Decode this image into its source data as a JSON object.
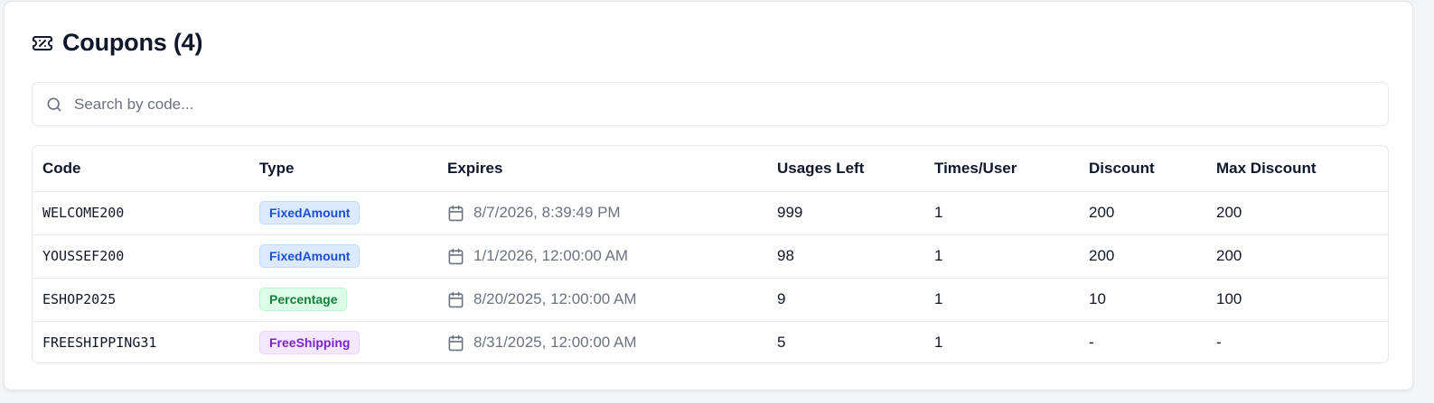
{
  "header": {
    "title": "Coupons (4)",
    "icon": "ticket-icon"
  },
  "search": {
    "placeholder": "Search by code...",
    "value": "",
    "icon": "search-icon"
  },
  "table": {
    "columns": [
      "Code",
      "Type",
      "Expires",
      "Usages Left",
      "Times/User",
      "Discount",
      "Max Discount"
    ],
    "rows": [
      {
        "code": "WELCOME200",
        "type": "FixedAmount",
        "type_color": "blue",
        "expires": "8/7/2026, 8:39:49 PM",
        "usages_left": "999",
        "times_per_user": "1",
        "discount": "200",
        "max_discount": "200"
      },
      {
        "code": "YOUSSEF200",
        "type": "FixedAmount",
        "type_color": "blue",
        "expires": "1/1/2026, 12:00:00 AM",
        "usages_left": "98",
        "times_per_user": "1",
        "discount": "200",
        "max_discount": "200"
      },
      {
        "code": "ESHOP2025",
        "type": "Percentage",
        "type_color": "green",
        "expires": "8/20/2025, 12:00:00 AM",
        "usages_left": "9",
        "times_per_user": "1",
        "discount": "10",
        "max_discount": "100"
      },
      {
        "code": "FREESHIPPING31",
        "type": "FreeShipping",
        "type_color": "purple",
        "expires": "8/31/2025, 12:00:00 AM",
        "usages_left": "5",
        "times_per_user": "1",
        "discount": "-",
        "max_discount": "-"
      }
    ]
  },
  "colors": {
    "blue_badge_bg": "#dbeafe",
    "blue_badge_text": "#1d4ed8",
    "green_badge_bg": "#dcfce7",
    "green_badge_text": "#15803d",
    "purple_badge_bg": "#f3e8ff",
    "purple_badge_text": "#7e22ce"
  }
}
